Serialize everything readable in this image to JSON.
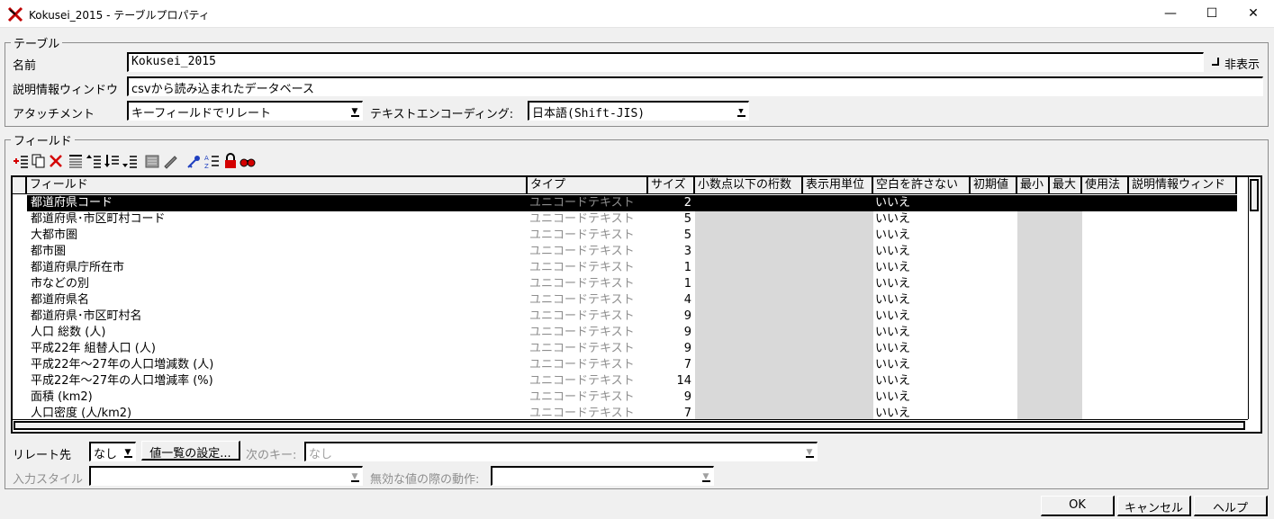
{
  "window": {
    "title": "Kokusei_2015 - テーブルプロパティ",
    "minimize_glyph": "—",
    "maximize_glyph": "☐",
    "close_glyph": "✕"
  },
  "table_group": {
    "legend": "テーブル",
    "name_label": "名前",
    "name_value": "Kokusei_2015",
    "hide_label": "非表示",
    "desc_label": "説明情報ウィンドウ",
    "desc_value": "csvから読み込まれたデータベース",
    "attach_label": "アタッチメント",
    "attach_value": "キーフィールドでリレート",
    "encoding_label": "テキストエンコーディング:",
    "encoding_value": "日本語(Shift-JIS)"
  },
  "field_group": {
    "legend": "フィールド",
    "toolbar_icons": [
      "add-field-icon",
      "copy-field-icon",
      "delete-field-icon",
      "move-top-icon",
      "move-up-icon",
      "move-down-icon",
      "move-bottom-icon",
      "stack-icon",
      "pencil-icon",
      "key-icon",
      "sort-icon",
      "lock-icon",
      "binoculars-icon"
    ]
  },
  "columns": [
    "フィールド",
    "タイプ",
    "サイズ",
    "小数点以下の桁数",
    "表示用単位",
    "空白を許さない",
    "初期値",
    "最小",
    "最大",
    "使用法",
    "説明情報ウィンド"
  ],
  "rows": [
    {
      "name": "都道府県コード",
      "type": "ユニコードテキスト",
      "size": "2",
      "notnull": "いいえ"
    },
    {
      "name": "都道府県･市区町村コード",
      "type": "ユニコードテキスト",
      "size": "5",
      "notnull": "いいえ"
    },
    {
      "name": "大都市圏",
      "type": "ユニコードテキスト",
      "size": "5",
      "notnull": "いいえ"
    },
    {
      "name": "都市圏",
      "type": "ユニコードテキスト",
      "size": "3",
      "notnull": "いいえ"
    },
    {
      "name": "都道府県庁所在市",
      "type": "ユニコードテキスト",
      "size": "1",
      "notnull": "いいえ"
    },
    {
      "name": "市などの別",
      "type": "ユニコードテキスト",
      "size": "1",
      "notnull": "いいえ"
    },
    {
      "name": "都道府県名",
      "type": "ユニコードテキスト",
      "size": "4",
      "notnull": "いいえ"
    },
    {
      "name": "都道府県･市区町村名",
      "type": "ユニコードテキスト",
      "size": "9",
      "notnull": "いいえ"
    },
    {
      "name": "人口 総数 (人)",
      "type": "ユニコードテキスト",
      "size": "9",
      "notnull": "いいえ"
    },
    {
      "name": "平成22年 組替人口 (人)",
      "type": "ユニコードテキスト",
      "size": "9",
      "notnull": "いいえ"
    },
    {
      "name": "平成22年～27年の人口増減数 (人)",
      "type": "ユニコードテキスト",
      "size": "7",
      "notnull": "いいえ"
    },
    {
      "name": "平成22年～27年の人口増減率 (%)",
      "type": "ユニコードテキスト",
      "size": "14",
      "notnull": "いいえ"
    },
    {
      "name": "面積 (km2)",
      "type": "ユニコードテキスト",
      "size": "9",
      "notnull": "いいえ"
    },
    {
      "name": "人口密度 (人/km2)",
      "type": "ユニコードテキスト",
      "size": "7",
      "notnull": "いいえ"
    }
  ],
  "selected_row": 0,
  "relation": {
    "relate_label": "リレート先",
    "relate_value": "なし",
    "value_list_button": "値一覧の設定...",
    "next_key_label": "次のキー:",
    "next_key_value": "なし",
    "input_style_label": "入力スタイル",
    "input_style_value": "",
    "invalid_action_label": "無効な値の際の動作:",
    "invalid_action_value": ""
  },
  "buttons": {
    "ok": "OK",
    "cancel": "キャンセル",
    "help": "ヘルプ"
  },
  "colors": {
    "accent_icon_red": "#d40000",
    "accent_icon_blue": "#1f3fbf",
    "selection": "#000000",
    "disabled_band": "#d9d9d9"
  }
}
